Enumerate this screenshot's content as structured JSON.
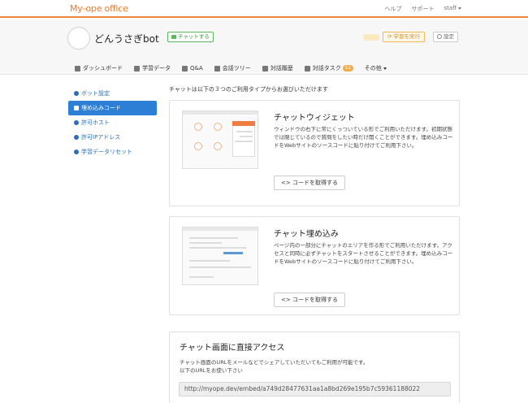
{
  "brand": "My-ope office",
  "top_links": {
    "help": "ヘルプ",
    "support": "サポート",
    "user": "staff"
  },
  "bot": {
    "name": "どんうさぎbot",
    "chat_button": "チャットする",
    "learn_button": "学習を実行",
    "settings_button": "設定"
  },
  "tabs": [
    {
      "label": "ダッシュボード",
      "icon": "dashboard-icon"
    },
    {
      "label": "学習データ",
      "icon": "table-icon"
    },
    {
      "label": "Q&A",
      "icon": "chat-icon"
    },
    {
      "label": "会話ツリー",
      "icon": "tree-icon"
    },
    {
      "label": "対話履歴",
      "icon": "history-icon"
    },
    {
      "label": "対話タスク",
      "icon": "task-icon",
      "badge": "11"
    },
    {
      "label": "その他",
      "icon": ""
    }
  ],
  "sidebar": {
    "items": [
      {
        "label": "ボット設定",
        "active": false
      },
      {
        "label": "埋め込みコード",
        "active": true
      },
      {
        "label": "許可ホスト",
        "active": false
      },
      {
        "label": "許可IPアドレス",
        "active": false
      },
      {
        "label": "学習データリセット",
        "active": false
      }
    ]
  },
  "main": {
    "intro": "チャットは以下の３つのご利用タイプからお選びいただけます",
    "cards": [
      {
        "title": "チャットウィジェット",
        "desc": "ウィンドウの右下に常にくっついている形でご利用いただけます。初期状態では閉じているので質問をしたい時だけ開くことができます。埋め込みコードをWebサイトのソースコードに貼り付けてご利用下さい。",
        "button": "<> コードを取得する"
      },
      {
        "title": "チャット埋め込み",
        "desc": "ページ内の一部分にチャットのエリアを作る形でご利用いただけます。アクセスと同時に必ずチャットをスタートさせることができます。埋め込みコードをWebサイトのソースコードに貼り付けてご利用下さい。",
        "button": "<> コードを取得する"
      },
      {
        "title": "チャット画面に直接アクセス",
        "desc_line1": "チャット画面のURLをメールなどでシェアしていただいてもご利用が可能です。",
        "desc_line2": "以下のURLをお使い下さい",
        "url": "http://myope.dev/embed/a749d28477631aa1a8bd269e195b7c59361188022"
      }
    ]
  },
  "colors": {
    "brand": "#ea7a2a",
    "active": "#2d7fd6",
    "learn": "#f0b75a",
    "chat": "#5cb85c"
  }
}
